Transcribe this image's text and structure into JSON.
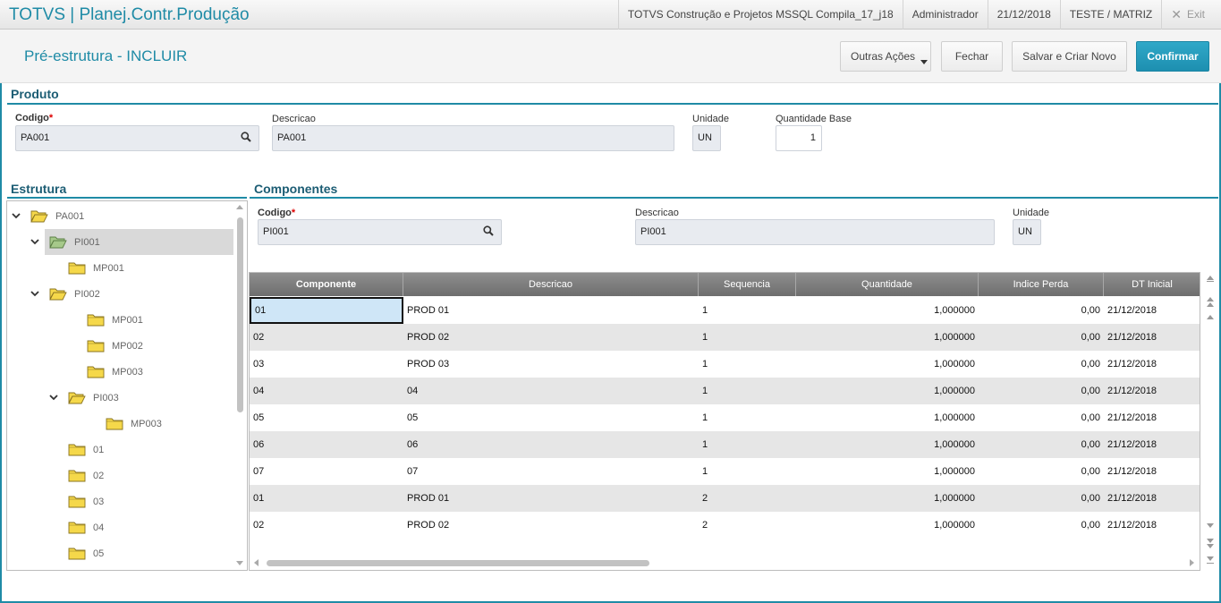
{
  "topbar": {
    "app_title": "TOTVS | Planej.Contr.Produção",
    "environment": "TOTVS Construção e Projetos MSSQL Compila_17_j18",
    "user": "Administrador",
    "date": "21/12/2018",
    "branch": "TESTE / MATRIZ",
    "exit_label": "Exit"
  },
  "header": {
    "title": "Pré-estrutura - INCLUIR",
    "buttons": {
      "outras": "Outras Ações",
      "fechar": "Fechar",
      "salvar": "Salvar e Criar Novo",
      "confirmar": "Confirmar"
    }
  },
  "produto": {
    "section_title": "Produto",
    "codigo_label": "Codigo",
    "required_mark": "*",
    "codigo_value": "PA001",
    "descricao_label": "Descricao",
    "descricao_value": "PA001",
    "unidade_label": "Unidade",
    "unidade_value": "UN",
    "qtd_label": "Quantidade Base",
    "qtd_value": "1"
  },
  "estrutura": {
    "section_title": "Estrutura",
    "nodes": [
      {
        "label": "PA001",
        "expanded": true
      },
      {
        "label": "PI001",
        "expanded": true,
        "selected": true
      },
      {
        "label": "MP001"
      },
      {
        "label": "PI002",
        "expanded": true
      },
      {
        "label": "MP001"
      },
      {
        "label": "MP002"
      },
      {
        "label": "MP003"
      },
      {
        "label": "PI003",
        "expanded": true
      },
      {
        "label": "MP003"
      },
      {
        "label": "01"
      },
      {
        "label": "02"
      },
      {
        "label": "03"
      },
      {
        "label": "04"
      },
      {
        "label": "05"
      }
    ]
  },
  "componentes": {
    "section_title": "Componentes",
    "codigo_label": "Codigo",
    "required_mark": "*",
    "codigo_value": "PI001",
    "descricao_label": "Descricao",
    "descricao_value": "PI001",
    "unidade_label": "Unidade",
    "unidade_value": "UN",
    "columns": [
      "Componente",
      "Descricao",
      "Sequencia",
      "Quantidade",
      "Indice Perda",
      "DT Inicial"
    ],
    "rows": [
      [
        "01",
        "PROD 01",
        "1",
        "1,000000",
        "0,00",
        "21/12/2018"
      ],
      [
        "02",
        "PROD 02",
        "1",
        "1,000000",
        "0,00",
        "21/12/2018"
      ],
      [
        "03",
        "PROD 03",
        "1",
        "1,000000",
        "0,00",
        "21/12/2018"
      ],
      [
        "04",
        "04",
        "1",
        "1,000000",
        "0,00",
        "21/12/2018"
      ],
      [
        "05",
        "05",
        "1",
        "1,000000",
        "0,00",
        "21/12/2018"
      ],
      [
        "06",
        "06",
        "1",
        "1,000000",
        "0,00",
        "21/12/2018"
      ],
      [
        "07",
        "07",
        "1",
        "1,000000",
        "0,00",
        "21/12/2018"
      ],
      [
        "01",
        "PROD 01",
        "2",
        "1,000000",
        "0,00",
        "21/12/2018"
      ],
      [
        "02",
        "PROD 02",
        "2",
        "1,000000",
        "0,00",
        "21/12/2018"
      ]
    ]
  },
  "colors": {
    "accent": "#1f8ba6",
    "confirm": "#1d8fb0",
    "folder": "#f5d84a"
  }
}
